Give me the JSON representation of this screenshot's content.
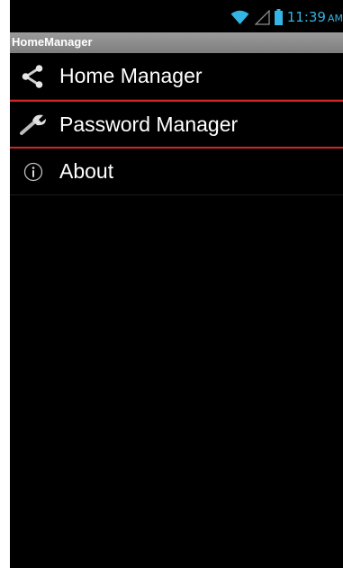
{
  "status_bar": {
    "time": "11:39",
    "ampm": "AM",
    "icons": [
      "wifi-icon",
      "signal-icon",
      "battery-icon"
    ],
    "accent_color": "#33b5e5"
  },
  "title_bar": {
    "title": "HomeManager"
  },
  "menu": {
    "items": [
      {
        "label": "Home Manager",
        "icon": "share-icon",
        "selected": false
      },
      {
        "label": "Password Manager",
        "icon": "wrench-icon",
        "selected": true
      },
      {
        "label": "About",
        "icon": "info-icon",
        "selected": false
      }
    ],
    "selection_color": "#d42525"
  }
}
